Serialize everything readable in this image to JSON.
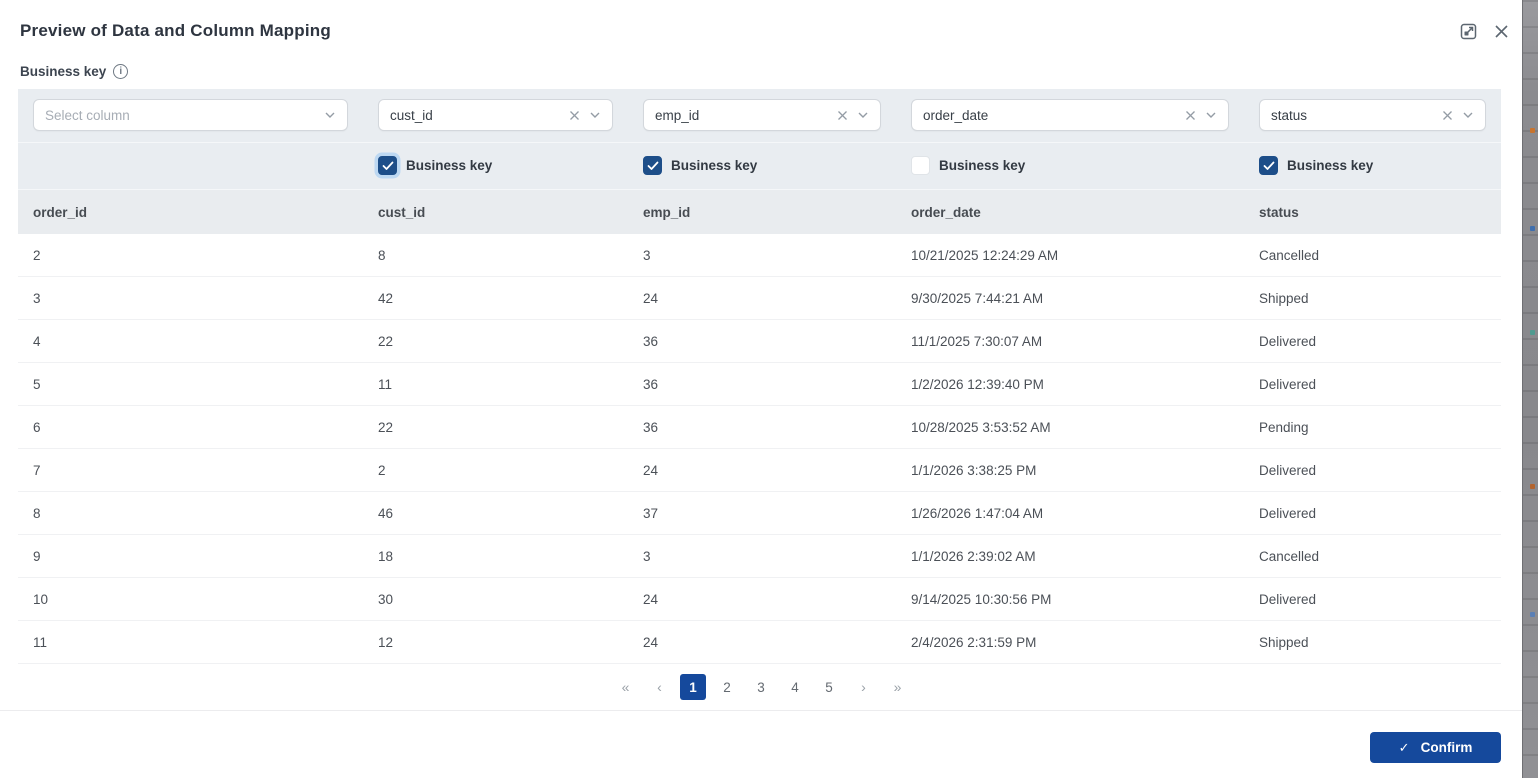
{
  "dialog": {
    "title": "Preview of Data and Column Mapping",
    "section_label": "Business key",
    "info_glyph": "i",
    "confirm": {
      "check": "✓",
      "label": "Confirm"
    }
  },
  "filters": {
    "checkbox_label": "Business key",
    "items": [
      {
        "value": "Select column",
        "is_placeholder": true,
        "clearable": false,
        "business_key": null
      },
      {
        "value": "cust_id",
        "is_placeholder": false,
        "clearable": true,
        "business_key": true,
        "focused": true
      },
      {
        "value": "emp_id",
        "is_placeholder": false,
        "clearable": true,
        "business_key": true
      },
      {
        "value": "order_date",
        "is_placeholder": false,
        "clearable": true,
        "business_key": false
      },
      {
        "value": "status",
        "is_placeholder": false,
        "clearable": true,
        "business_key": true
      }
    ]
  },
  "table": {
    "headers": [
      "order_id",
      "cust_id",
      "emp_id",
      "order_date",
      "status"
    ],
    "rows": [
      [
        "2",
        "8",
        "3",
        "10/21/2025 12:24:29 AM",
        "Cancelled"
      ],
      [
        "3",
        "42",
        "24",
        "9/30/2025 7:44:21 AM",
        "Shipped"
      ],
      [
        "4",
        "22",
        "36",
        "11/1/2025 7:30:07 AM",
        "Delivered"
      ],
      [
        "5",
        "11",
        "36",
        "1/2/2026 12:39:40 PM",
        "Delivered"
      ],
      [
        "6",
        "22",
        "36",
        "10/28/2025 3:53:52 AM",
        "Pending"
      ],
      [
        "7",
        "2",
        "24",
        "1/1/2026 3:38:25 PM",
        "Delivered"
      ],
      [
        "8",
        "46",
        "37",
        "1/26/2026 1:47:04 AM",
        "Delivered"
      ],
      [
        "9",
        "18",
        "3",
        "1/1/2026 2:39:02 AM",
        "Cancelled"
      ],
      [
        "10",
        "30",
        "24",
        "9/14/2025 10:30:56 PM",
        "Delivered"
      ],
      [
        "11",
        "12",
        "24",
        "2/4/2026 2:31:59 PM",
        "Shipped"
      ]
    ]
  },
  "pagination": {
    "first": "«",
    "prev": "‹",
    "pages": [
      "1",
      "2",
      "3",
      "4",
      "5"
    ],
    "active_page": "1",
    "next": "›",
    "last": "»"
  },
  "colors": {
    "accent_blue": "#15499c",
    "checkbox_blue": "#1d4e89",
    "panel_gray": "#e9edf1",
    "header_gray": "#e9ecef"
  }
}
